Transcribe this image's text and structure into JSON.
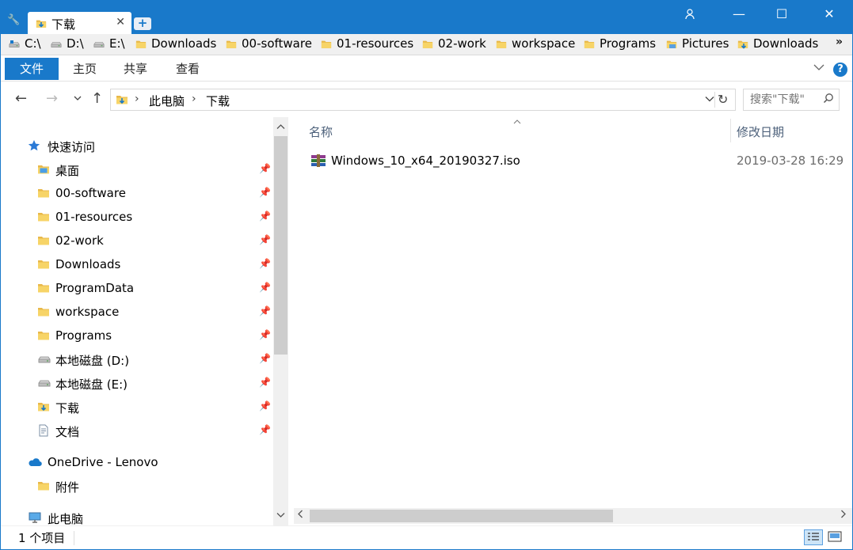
{
  "titlebar": {
    "tab_label": "下载",
    "tab_close": "✕",
    "new_tab": "+",
    "minimize": "—",
    "maximize": "☐",
    "close": "✕"
  },
  "bookmarks": [
    {
      "label": "C:\\",
      "icon": "drive-c-icon"
    },
    {
      "label": "D:\\",
      "icon": "drive-icon"
    },
    {
      "label": "E:\\",
      "icon": "drive-icon"
    },
    {
      "label": "Downloads",
      "icon": "folder-icon"
    },
    {
      "label": "00-software",
      "icon": "folder-icon"
    },
    {
      "label": "01-resources",
      "icon": "folder-icon"
    },
    {
      "label": "02-work",
      "icon": "folder-icon"
    },
    {
      "label": "workspace",
      "icon": "folder-icon"
    },
    {
      "label": "Programs",
      "icon": "folder-icon"
    },
    {
      "label": "Pictures",
      "icon": "pictures-folder-icon"
    },
    {
      "label": "Downloads",
      "icon": "downloads-folder-icon"
    }
  ],
  "bookmarks_more": "»",
  "ribbon": {
    "file": "文件",
    "home": "主页",
    "share": "共享",
    "view": "查看",
    "help": "?"
  },
  "address": {
    "crumbs": [
      "此电脑",
      "下载"
    ],
    "search_placeholder": "搜索\"下载\""
  },
  "navpane": {
    "quick_access": "快速访问",
    "pinned": [
      {
        "label": "桌面",
        "icon": "desktop-folder-icon"
      },
      {
        "label": "00-software",
        "icon": "folder-icon"
      },
      {
        "label": "01-resources",
        "icon": "folder-icon"
      },
      {
        "label": "02-work",
        "icon": "folder-icon"
      },
      {
        "label": "Downloads",
        "icon": "folder-icon"
      },
      {
        "label": "ProgramData",
        "icon": "folder-icon"
      },
      {
        "label": "workspace",
        "icon": "folder-icon"
      },
      {
        "label": "Programs",
        "icon": "folder-icon"
      },
      {
        "label": "本地磁盘 (D:)",
        "icon": "drive-icon"
      },
      {
        "label": "本地磁盘 (E:)",
        "icon": "drive-icon"
      },
      {
        "label": "下载",
        "icon": "downloads-folder-icon"
      },
      {
        "label": "文档",
        "icon": "documents-icon"
      }
    ],
    "onedrive": "OneDrive - Lenovo",
    "onedrive_child": "附件",
    "this_pc": "此电脑"
  },
  "content": {
    "col_name": "名称",
    "col_date": "修改日期",
    "files": [
      {
        "name": "Windows_10_x64_20190327.iso",
        "date": "2019-03-28 16:29",
        "icon": "winrar-archive-icon"
      }
    ]
  },
  "status": {
    "count": "1 个项目"
  },
  "colors": {
    "accent": "#1979ca",
    "folder": "#f6c94d"
  }
}
